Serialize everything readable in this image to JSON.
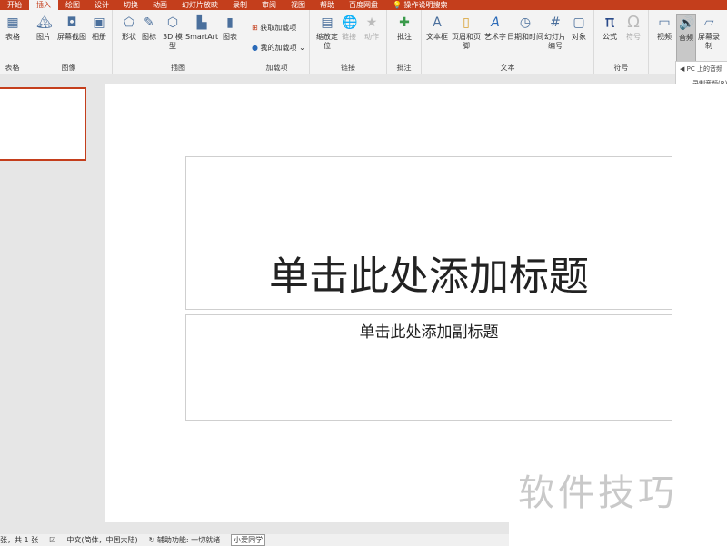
{
  "tabs": [
    "开始",
    "插入",
    "绘图",
    "设计",
    "切换",
    "动画",
    "幻灯片放映",
    "录制",
    "审阅",
    "视图",
    "帮助",
    "百度网盘",
    "操作说明搜索"
  ],
  "active_tab": "插入",
  "accent": "#c43e1c",
  "ribbon": {
    "groups": {
      "table": "表格",
      "images": "图像",
      "illustrations": "插图",
      "addins": "加载项",
      "links": "链接",
      "comments": "批注",
      "text": "文本",
      "symbols": "符号"
    },
    "buttons": {
      "table": "表格",
      "picture": "图片",
      "screenshot": "屏幕截图",
      "album": "相册",
      "shapes": "形状",
      "icons": "图标",
      "model3d": "3D 模型",
      "smartart": "SmartArt",
      "chart": "图表",
      "get_addins": "获取加载项",
      "my_addins": "我的加载项",
      "zoom": "缩放定位",
      "link": "链接",
      "action": "动作",
      "comment": "批注",
      "textbox": "文本框",
      "header_footer": "页眉和页脚",
      "wordart": "艺术字",
      "datetime": "日期和时间",
      "slide_number": "幻灯片编号",
      "object": "对象",
      "equation": "公式",
      "symbol": "符号",
      "video": "视频",
      "audio": "音频",
      "screen_recording": "屏幕录制"
    }
  },
  "audio_menu": [
    "PC 上的音频",
    "录制音频(R)"
  ],
  "slide": {
    "title_placeholder": "单击此处添加标题",
    "subtitle_placeholder": "单击此处添加副标题"
  },
  "status": {
    "slide_count": "张，共 1 张",
    "language": "中文(简体，中国大陆)",
    "accessibility": "辅助功能: 一切就绪",
    "ime": "小爱同学"
  },
  "watermark": "软件技巧"
}
